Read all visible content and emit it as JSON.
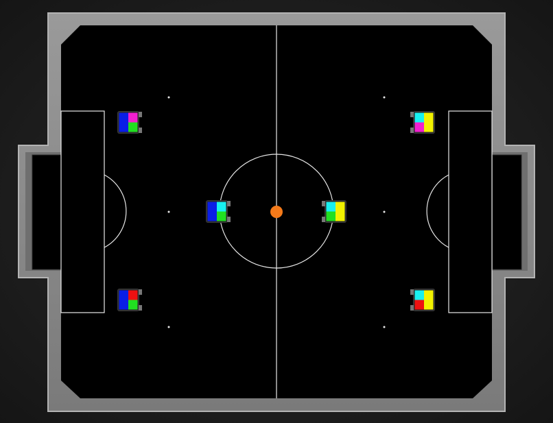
{
  "scene": {
    "title": "",
    "field_color": "#000000",
    "wall_color": "#8a8a8a",
    "line_color": "#e8e8e8",
    "ball_color": "#f47a1a"
  },
  "teams": [
    {
      "name": "blue",
      "side": "left",
      "base_color": "#0a1ee6",
      "robots": [
        {
          "id": "blue-1",
          "patches": [
            "#f21fd0",
            "#21e021"
          ]
        },
        {
          "id": "blue-2",
          "patches": [
            "#18f0f0",
            "#21e021"
          ]
        },
        {
          "id": "blue-3",
          "patches": [
            "#ee1111",
            "#21e021"
          ]
        }
      ]
    },
    {
      "name": "yellow",
      "side": "right",
      "base_color": "#f2f200",
      "robots": [
        {
          "id": "yellow-1",
          "patches": [
            "#18f0f0",
            "#f21fd0"
          ]
        },
        {
          "id": "yellow-2",
          "patches": [
            "#18f0f0",
            "#21e021"
          ]
        },
        {
          "id": "yellow-3",
          "patches": [
            "#18f0f0",
            "#ee1111"
          ]
        }
      ]
    }
  ],
  "ball": {
    "label": "ball"
  }
}
